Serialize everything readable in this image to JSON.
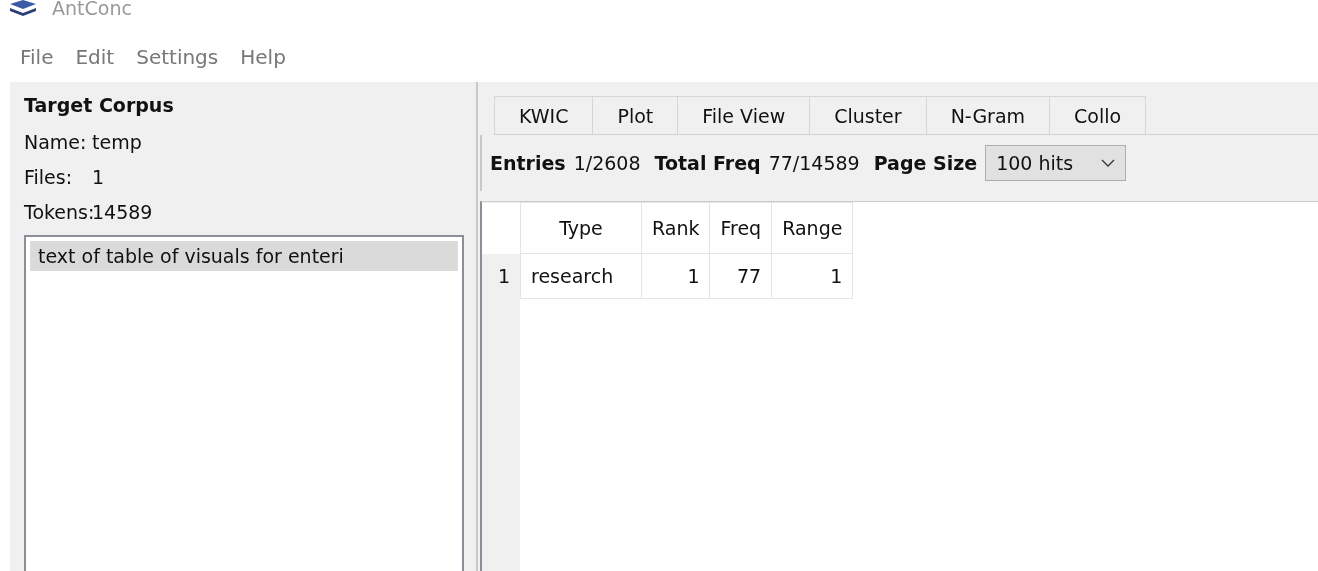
{
  "window": {
    "title": "AntConc"
  },
  "menu": [
    "File",
    "Edit",
    "Settings",
    "Help"
  ],
  "corpus": {
    "heading": "Target Corpus",
    "fields": [
      {
        "label": "Name:",
        "value": "temp"
      },
      {
        "label": "Files:",
        "value": "1"
      },
      {
        "label": "Tokens:",
        "value": "14589"
      }
    ],
    "files": [
      {
        "name": "text of table of visuals for enteri",
        "selected": true
      }
    ]
  },
  "tabs": [
    "KWIC",
    "Plot",
    "File View",
    "Cluster",
    "N-Gram",
    "Collo"
  ],
  "stats": [
    {
      "label": "Entries",
      "value": "1/2608"
    },
    {
      "label": "Total Freq",
      "value": "77/14589"
    }
  ],
  "page_size": {
    "label": "Page Size",
    "value": "100 hits"
  },
  "table": {
    "columns": [
      "Type",
      "Rank",
      "Freq",
      "Range"
    ],
    "rows": [
      {
        "index": "1",
        "cells": [
          "research",
          "1",
          "77",
          "1"
        ]
      }
    ]
  }
}
